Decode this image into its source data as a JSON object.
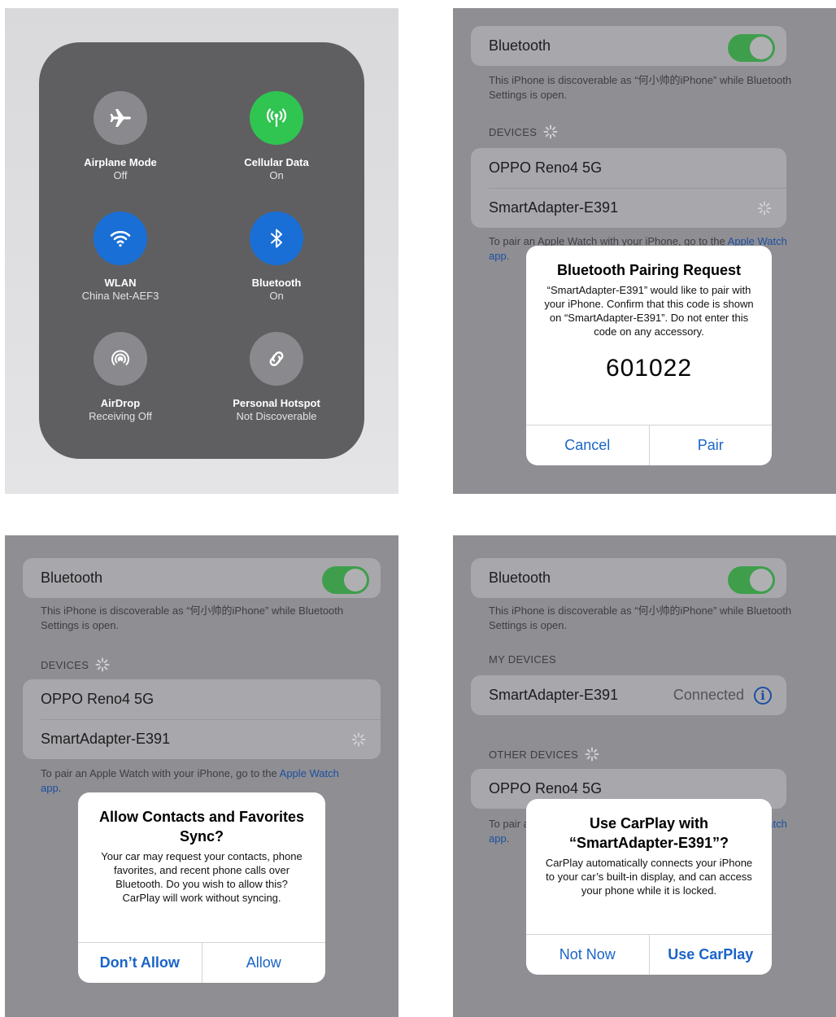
{
  "control_center": {
    "airplane": {
      "label": "Airplane Mode",
      "status": "Off"
    },
    "cellular": {
      "label": "Cellular Data",
      "status": "On"
    },
    "wlan": {
      "label": "WLAN",
      "status": "China Net-AEF3"
    },
    "bluetooth": {
      "label": "Bluetooth",
      "status": "On"
    },
    "airdrop": {
      "label": "AirDrop",
      "status": "Receiving Off"
    },
    "hotspot": {
      "label": "Personal Hotspot",
      "status": "Not Discoverable"
    }
  },
  "bluetooth_settings": {
    "title": "Bluetooth",
    "discoverable_note": "This iPhone is discoverable as “何小帅的iPhone” while Bluetooth Settings is open.",
    "devices_header": "DEVICES",
    "my_devices_header": "MY DEVICES",
    "other_devices_header": "OTHER DEVICES",
    "device_oppo": "OPPO Reno4 5G",
    "device_adapter": "SmartAdapter-E391",
    "connected_status": "Connected",
    "watch_note_prefix": "To pair an Apple Watch with your iPhone, go to the ",
    "watch_link": "Apple Watch app",
    "watch_note_suffix": "."
  },
  "pairing_alert": {
    "title": "Bluetooth Pairing Request",
    "message": "“SmartAdapter-E391” would like to pair with your iPhone. Confirm that this code is shown on “SmartAdapter-E391”. Do not enter this code on any accessory.",
    "code": "601022",
    "cancel_label": "Cancel",
    "pair_label": "Pair"
  },
  "contacts_alert": {
    "title": "Allow Contacts and Favorites Sync?",
    "message": "Your car may request your contacts, phone favorites, and recent phone calls over Bluetooth. Do you wish to allow this? CarPlay will work without syncing.",
    "dont_allow_label": "Don’t Allow",
    "allow_label": "Allow"
  },
  "carplay_alert": {
    "title": "Use CarPlay with “SmartAdapter-E391”?",
    "message": "CarPlay automatically connects your iPhone to your car’s built-in display, and can access your phone while it is locked.",
    "not_now_label": "Not Now",
    "use_label": "Use CarPlay"
  },
  "colors": {
    "toggle_on": "#3f9e4c",
    "link": "#1a64c8",
    "cellular": "#30c451",
    "active_blue": "#1a6fd6"
  },
  "icons": [
    "airplane-icon",
    "antenna-icon",
    "wifi-icon",
    "bluetooth-icon",
    "airdrop-icon",
    "hotspot-icon",
    "spinner-icon",
    "info-icon"
  ]
}
